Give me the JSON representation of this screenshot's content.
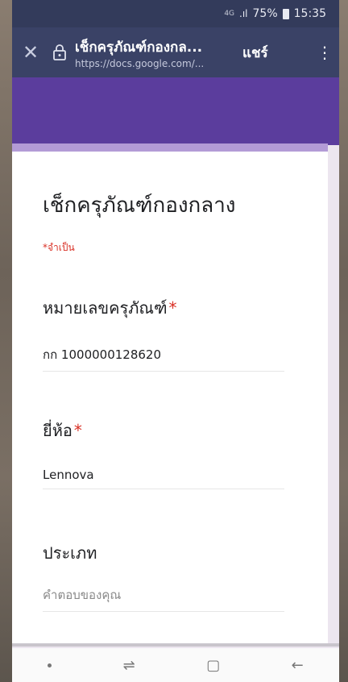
{
  "status": {
    "network": "4G",
    "signal": ".ıl",
    "battery": "75%",
    "time": "15:35"
  },
  "toolbar": {
    "title": "เช็กครุภัณฑ์กองกล...",
    "url": "https://docs.google.com/...",
    "share_label": "แชร์",
    "menu_label": "⋮",
    "close_label": "✕"
  },
  "form": {
    "title": "เช็กครุภัณฑ์กองกลาง",
    "required_note": "*จำเป็น",
    "questions": [
      {
        "label": "หมายเลขครุภัณฑ์",
        "required_mark": "*",
        "value": "กก 1000000128620"
      },
      {
        "label": "ยี่ห้อ",
        "required_mark": "*",
        "value": "Lennova"
      },
      {
        "label": "ประเภท",
        "placeholder": "คำตอบของคุณ"
      }
    ]
  },
  "navbar": {
    "recent_label": "⇌",
    "home_label": "▢",
    "back_label": "←"
  }
}
